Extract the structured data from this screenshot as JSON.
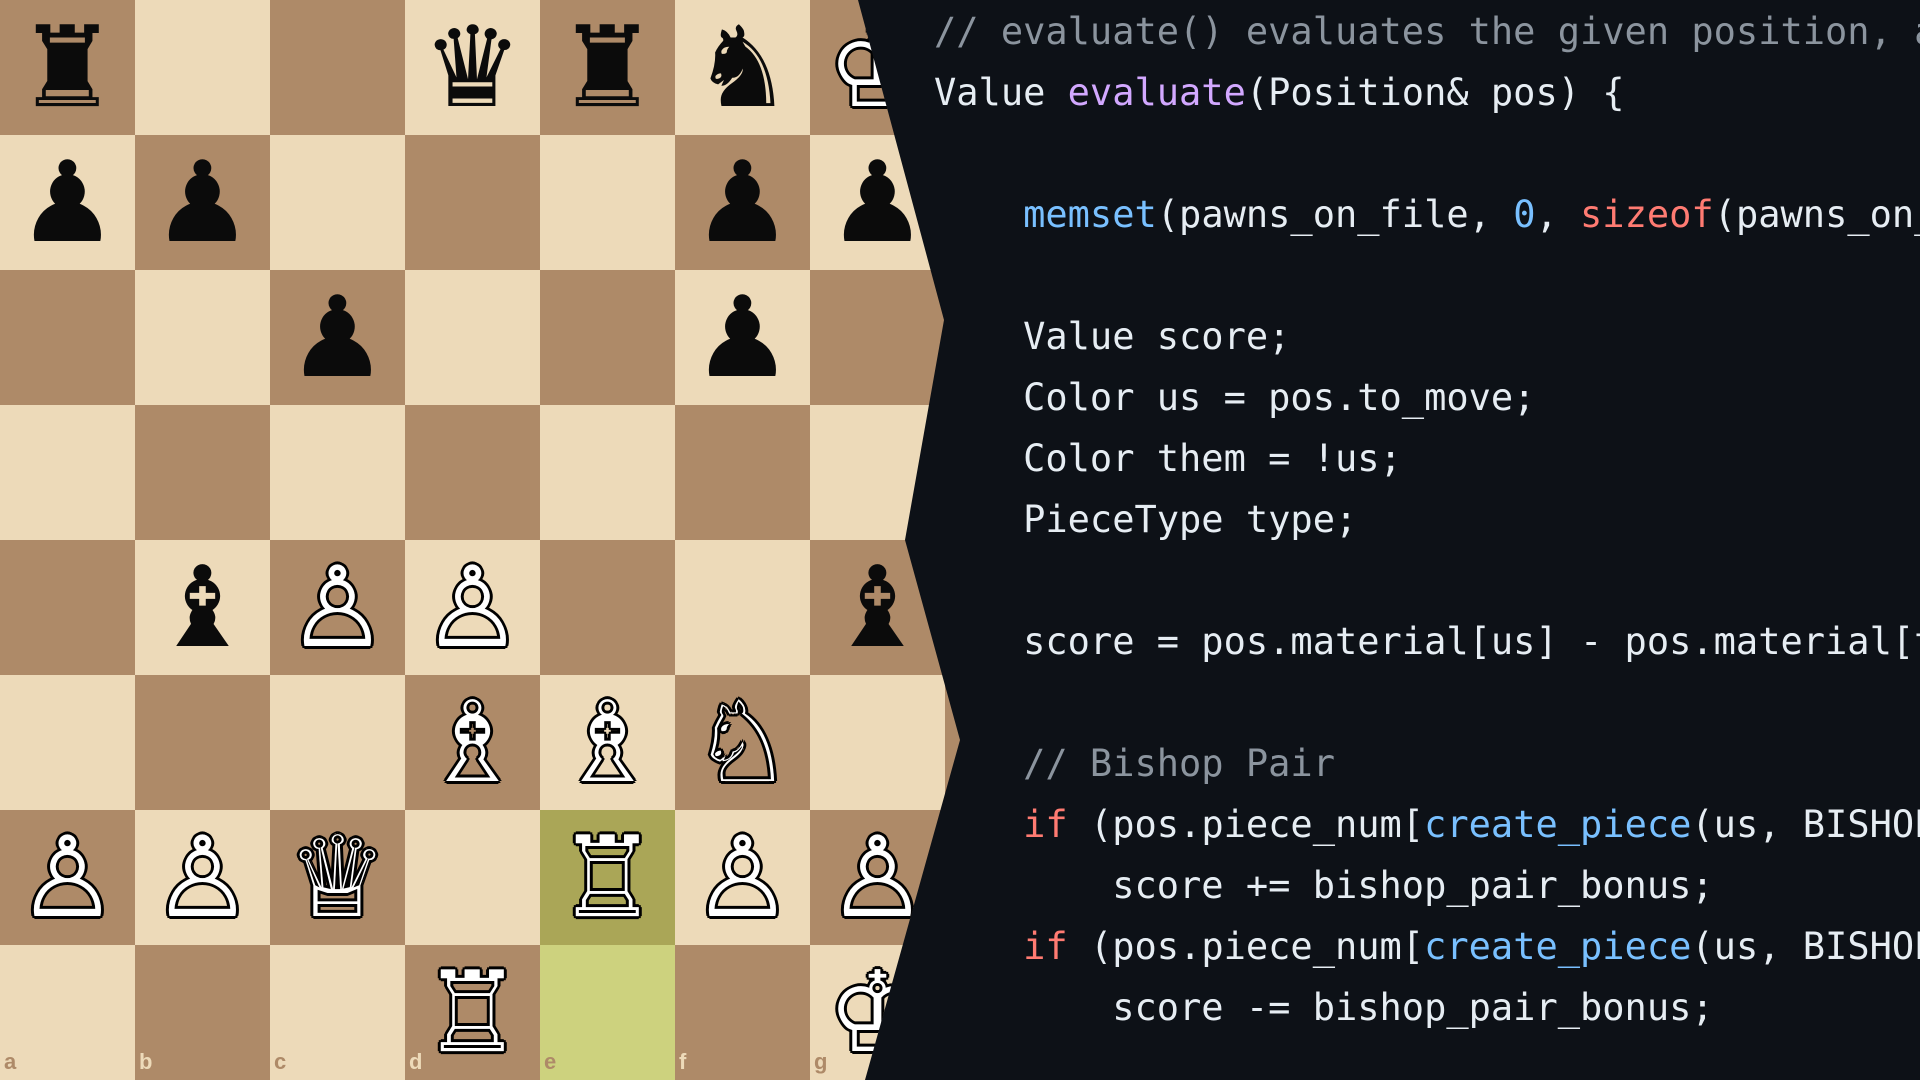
{
  "colors": {
    "light_square": "#eddab9",
    "dark_square": "#ae8a68",
    "highlight_light": "#cdd27e",
    "highlight_dark": "#aaa657",
    "code_background": "#0d1117",
    "comment": "#8b949e",
    "function_name": "#d2a8ff",
    "call": "#79c0ff",
    "keyword": "#ff7b72",
    "text": "#e6edf3"
  },
  "board": {
    "files_visible": [
      "a",
      "b",
      "c",
      "d",
      "e",
      "f",
      "g"
    ],
    "highlighted_squares": [
      "e2",
      "e1"
    ],
    "pieces": [
      {
        "square": "a8",
        "glyph": "♜",
        "color": "black",
        "icon": "rook-icon"
      },
      {
        "square": "d8",
        "glyph": "♛",
        "color": "black",
        "icon": "queen-icon"
      },
      {
        "square": "e8",
        "glyph": "♜",
        "color": "black",
        "icon": "rook-icon"
      },
      {
        "square": "f8",
        "glyph": "♞",
        "color": "black",
        "icon": "knight-icon"
      },
      {
        "square": "g8",
        "glyph": "♔",
        "color": "white",
        "icon": "king-icon"
      },
      {
        "square": "a7",
        "glyph": "♟",
        "color": "black",
        "icon": "pawn-icon"
      },
      {
        "square": "b7",
        "glyph": "♟",
        "color": "black",
        "icon": "pawn-icon"
      },
      {
        "square": "f7",
        "glyph": "♟",
        "color": "black",
        "icon": "pawn-icon"
      },
      {
        "square": "g7",
        "glyph": "♟",
        "color": "black",
        "icon": "pawn-icon"
      },
      {
        "square": "c6",
        "glyph": "♟",
        "color": "black",
        "icon": "pawn-icon"
      },
      {
        "square": "f6",
        "glyph": "♟",
        "color": "black",
        "icon": "pawn-icon"
      },
      {
        "square": "b4",
        "glyph": "♝",
        "color": "black",
        "icon": "bishop-icon"
      },
      {
        "square": "c4",
        "glyph": "♙",
        "color": "white",
        "icon": "pawn-icon"
      },
      {
        "square": "d4",
        "glyph": "♙",
        "color": "white",
        "icon": "pawn-icon"
      },
      {
        "square": "g4",
        "glyph": "♝",
        "color": "black",
        "icon": "bishop-icon"
      },
      {
        "square": "d3",
        "glyph": "♗",
        "color": "white",
        "icon": "bishop-icon"
      },
      {
        "square": "e3",
        "glyph": "♗",
        "color": "white",
        "icon": "bishop-icon"
      },
      {
        "square": "f3",
        "glyph": "♘",
        "color": "white",
        "icon": "knight-icon"
      },
      {
        "square": "a2",
        "glyph": "♙",
        "color": "white",
        "icon": "pawn-icon"
      },
      {
        "square": "b2",
        "glyph": "♙",
        "color": "white",
        "icon": "pawn-icon"
      },
      {
        "square": "c2",
        "glyph": "♕",
        "color": "white",
        "icon": "queen-icon"
      },
      {
        "square": "e2",
        "glyph": "♖",
        "color": "white",
        "icon": "rook-icon"
      },
      {
        "square": "f2",
        "glyph": "♙",
        "color": "white",
        "icon": "pawn-icon"
      },
      {
        "square": "g2",
        "glyph": "♙",
        "color": "white",
        "icon": "pawn-icon"
      },
      {
        "square": "d1",
        "glyph": "♖",
        "color": "white",
        "icon": "rook-icon"
      },
      {
        "square": "g1",
        "glyph": "♔",
        "color": "white",
        "icon": "king-icon"
      }
    ]
  },
  "code": {
    "lines": [
      [
        {
          "t": "// evaluate() evaluates the given position, a",
          "c": "comment"
        }
      ],
      [
        {
          "t": "Value ",
          "c": "plain"
        },
        {
          "t": "evaluate",
          "c": "func"
        },
        {
          "t": "(Position& pos) {",
          "c": "plain"
        }
      ],
      [],
      [
        {
          "t": "    ",
          "c": "plain"
        },
        {
          "t": "memset",
          "c": "call"
        },
        {
          "t": "(pawns_on_file, ",
          "c": "plain"
        },
        {
          "t": "0",
          "c": "num"
        },
        {
          "t": ", ",
          "c": "plain"
        },
        {
          "t": "sizeof",
          "c": "kw"
        },
        {
          "t": "(pawns_on_",
          "c": "plain"
        }
      ],
      [],
      [
        {
          "t": "    Value score;",
          "c": "plain"
        }
      ],
      [
        {
          "t": "    Color us = pos.to_move;",
          "c": "plain"
        }
      ],
      [
        {
          "t": "    Color them = !us;",
          "c": "plain"
        }
      ],
      [
        {
          "t": "    PieceType type;",
          "c": "plain"
        }
      ],
      [],
      [
        {
          "t": "    score = pos.material[us] - pos.material[t",
          "c": "plain"
        }
      ],
      [],
      [
        {
          "t": "    // Bishop Pair",
          "c": "comment"
        }
      ],
      [
        {
          "t": "    ",
          "c": "plain"
        },
        {
          "t": "if",
          "c": "kw"
        },
        {
          "t": " (pos.piece_num[",
          "c": "plain"
        },
        {
          "t": "create_piece",
          "c": "call"
        },
        {
          "t": "(us, BISHOP",
          "c": "plain"
        }
      ],
      [
        {
          "t": "        score += bishop_pair_bonus;",
          "c": "plain"
        }
      ],
      [
        {
          "t": "    ",
          "c": "plain"
        },
        {
          "t": "if",
          "c": "kw"
        },
        {
          "t": " (pos.piece_num[",
          "c": "plain"
        },
        {
          "t": "create_piece",
          "c": "call"
        },
        {
          "t": "(us, BISHOP",
          "c": "plain"
        }
      ],
      [
        {
          "t": "        score -= bishop_pair_bonus;",
          "c": "plain"
        }
      ]
    ]
  }
}
